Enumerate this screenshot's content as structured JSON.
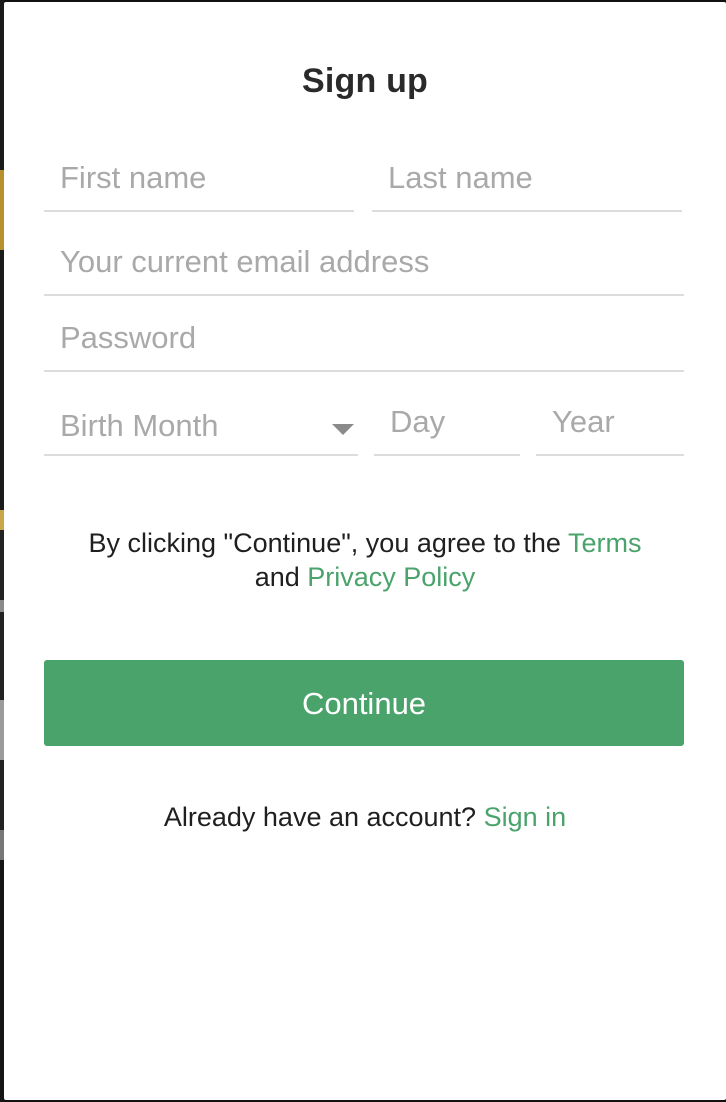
{
  "modal": {
    "title": "Sign up"
  },
  "form": {
    "first_name_placeholder": "First name",
    "last_name_placeholder": "Last name",
    "email_placeholder": "Your current email address",
    "password_placeholder": "Password",
    "birth_month_label": "Birth Month",
    "day_placeholder": "Day",
    "year_placeholder": "Year"
  },
  "terms": {
    "prefix": "By clicking \"Continue\", you agree to the ",
    "terms_link": "Terms",
    "middle": " and ",
    "privacy_link": "Privacy Policy"
  },
  "actions": {
    "continue_label": "Continue",
    "signin_prompt": "Already have an account? ",
    "signin_link": "Sign in"
  },
  "colors": {
    "accent": "#4aa36b",
    "field_underline": "#dcdcdc",
    "placeholder": "#a9a9a9"
  }
}
